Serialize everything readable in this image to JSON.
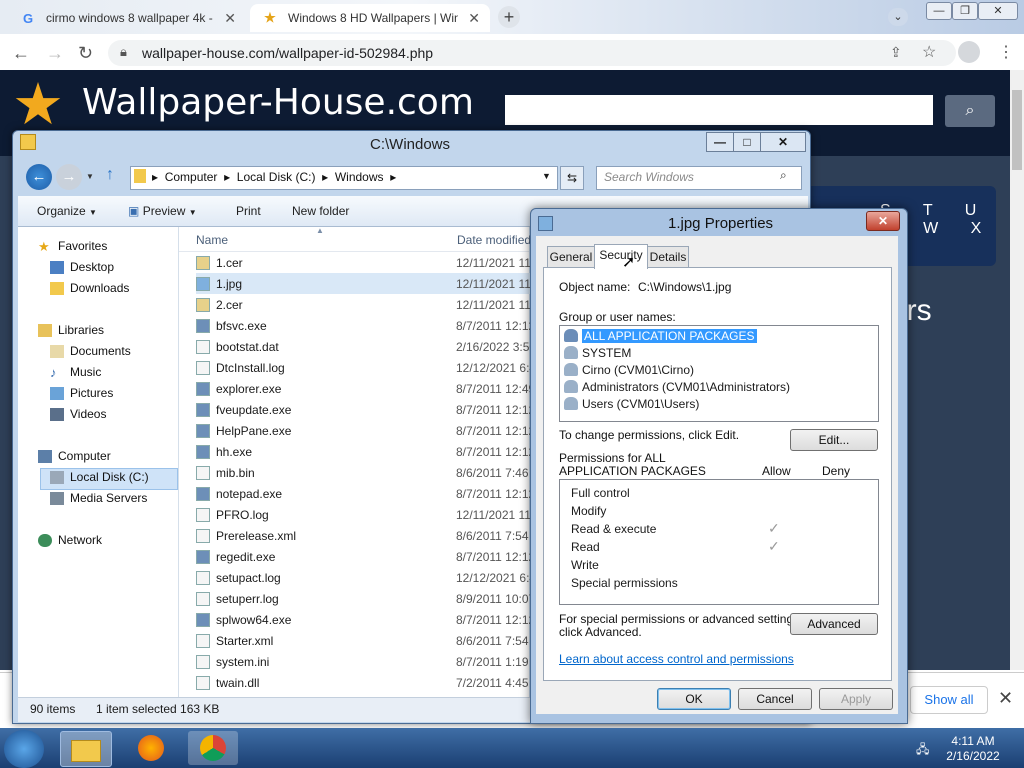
{
  "browser": {
    "tabs": [
      {
        "title": "cirmo windows 8 wallpaper 4k - ",
        "favicon": "G"
      },
      {
        "title": "Windows 8 HD Wallpapers | Win",
        "favicon": "★"
      }
    ],
    "new_tab": "+",
    "url": "wallpaper-house.com/wallpaper-id-502984.php",
    "download_bar": {
      "show_all": "Show all"
    }
  },
  "website": {
    "title": "Wallpaper-House.com",
    "nav_letters": "S T U V W X",
    "partial_heading": "ers"
  },
  "explorer": {
    "title": "C:\\Windows",
    "breadcrumb": [
      "Computer",
      "Local Disk (C:)",
      "Windows"
    ],
    "search_placeholder": "Search Windows",
    "commands": {
      "organize": "Organize",
      "preview": "Preview",
      "print": "Print",
      "new_folder": "New folder"
    },
    "nav": {
      "favorites": "Favorites",
      "desktop": "Desktop",
      "downloads": "Downloads",
      "libraries": "Libraries",
      "documents": "Documents",
      "music": "Music",
      "pictures": "Pictures",
      "videos": "Videos",
      "computer": "Computer",
      "local_disk": "Local Disk (C:)",
      "media_servers": "Media Servers",
      "network": "Network"
    },
    "columns": {
      "name": "Name",
      "date": "Date modified"
    },
    "files": [
      {
        "name": "1.cer",
        "date": "12/11/2021 11"
      },
      {
        "name": "1.jpg",
        "date": "12/11/2021 11"
      },
      {
        "name": "2.cer",
        "date": "12/11/2021 11"
      },
      {
        "name": "bfsvc.exe",
        "date": "8/7/2011 12:12"
      },
      {
        "name": "bootstat.dat",
        "date": "2/16/2022 3:50"
      },
      {
        "name": "DtcInstall.log",
        "date": "12/12/2021 6:4"
      },
      {
        "name": "explorer.exe",
        "date": "8/7/2011 12:49"
      },
      {
        "name": "fveupdate.exe",
        "date": "8/7/2011 12:12"
      },
      {
        "name": "HelpPane.exe",
        "date": "8/7/2011 12:12"
      },
      {
        "name": "hh.exe",
        "date": "8/7/2011 12:12"
      },
      {
        "name": "mib.bin",
        "date": "8/6/2011 7:46"
      },
      {
        "name": "notepad.exe",
        "date": "8/7/2011 12:12"
      },
      {
        "name": "PFRO.log",
        "date": "12/11/2021 11"
      },
      {
        "name": "Prerelease.xml",
        "date": "8/6/2011 7:54"
      },
      {
        "name": "regedit.exe",
        "date": "8/7/2011 12:12"
      },
      {
        "name": "setupact.log",
        "date": "12/12/2021 6:4"
      },
      {
        "name": "setuperr.log",
        "date": "8/9/2011 10:07"
      },
      {
        "name": "splwow64.exe",
        "date": "8/7/2011 12:12"
      },
      {
        "name": "Starter.xml",
        "date": "8/6/2011 7:54"
      },
      {
        "name": "system.ini",
        "date": "8/7/2011 1:19"
      },
      {
        "name": "twain.dll",
        "date": "7/2/2011 4:45"
      }
    ],
    "status": {
      "items": "90 items",
      "selected": "1 item selected  163 KB"
    }
  },
  "properties": {
    "title": "1.jpg Properties",
    "tabs": {
      "general": "General",
      "security": "Security",
      "details": "Details"
    },
    "object_name_label": "Object name:",
    "object_name_value": "C:\\Windows\\1.jpg",
    "groups_label": "Group or user names:",
    "groups": [
      "ALL APPLICATION PACKAGES",
      "SYSTEM",
      "Cirno (CVM01\\Cirno)",
      "Administrators (CVM01\\Administrators)",
      "Users (CVM01\\Users)"
    ],
    "change_text": "To change permissions, click Edit.",
    "edit_button": "Edit...",
    "perm_for_1": "Permissions for ALL",
    "perm_for_2": "APPLICATION PACKAGES",
    "allow_header": "Allow",
    "deny_header": "Deny",
    "permissions": [
      "Full control",
      "Modify",
      "Read & execute",
      "Read",
      "Write",
      "Special permissions"
    ],
    "allowed": [
      false,
      false,
      true,
      true,
      false,
      false
    ],
    "special_text_1": "For special permissions or advanced settings,",
    "special_text_2": "click Advanced.",
    "advanced_button": "Advanced",
    "learn_link": "Learn about access control and permissions",
    "ok": "OK",
    "cancel": "Cancel",
    "apply": "Apply"
  },
  "taskbar": {
    "time": "4:11 AM",
    "date": "2/16/2022"
  }
}
